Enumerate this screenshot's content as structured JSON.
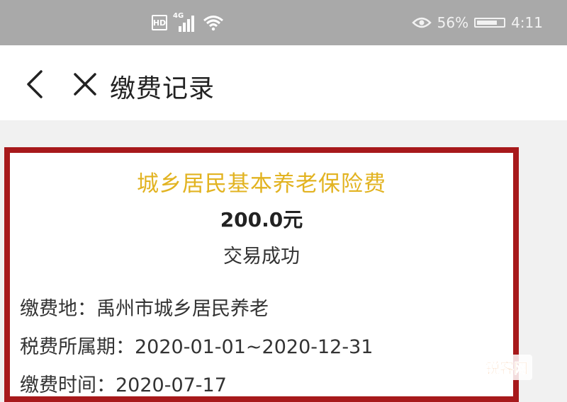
{
  "status_bar": {
    "sim_label": "HD",
    "network_label": "4G",
    "battery_percent_text": "56%",
    "time": "4:11",
    "icons": [
      "sim-icon",
      "signal-icon",
      "wifi-icon",
      "eye-icon",
      "battery-icon"
    ]
  },
  "nav": {
    "title": "缴费记录",
    "back_icon": "chevron-left-icon",
    "close_icon": "close-icon"
  },
  "record": {
    "title": "城乡居民基本养老保险费",
    "amount": "200.0元",
    "status": "交易成功",
    "fields": [
      {
        "label": "缴费地：",
        "value": "禹州市城乡居民养老"
      },
      {
        "label": "税费所属期：",
        "value": "2020-01-01~2020-12-31"
      },
      {
        "label": "缴费时间：",
        "value": "2020-07-17"
      }
    ]
  },
  "colors": {
    "status_bar": "#a9a9a9",
    "highlight_border": "#a7191b",
    "title_yellow": "#e2b321",
    "text": "#222222"
  },
  "watermark": {
    "text": "锐客网"
  }
}
